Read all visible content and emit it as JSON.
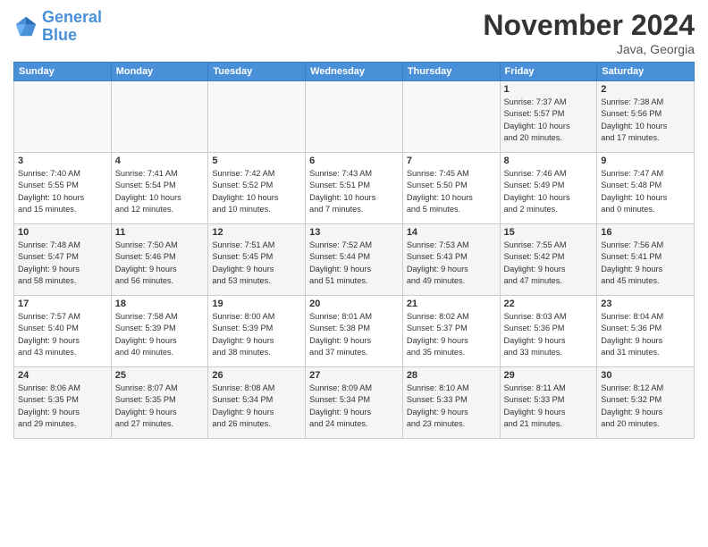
{
  "logo": {
    "line1": "General",
    "line2": "Blue"
  },
  "title": "November 2024",
  "location": "Java, Georgia",
  "days_of_week": [
    "Sunday",
    "Monday",
    "Tuesday",
    "Wednesday",
    "Thursday",
    "Friday",
    "Saturday"
  ],
  "weeks": [
    [
      {
        "day": "",
        "info": ""
      },
      {
        "day": "",
        "info": ""
      },
      {
        "day": "",
        "info": ""
      },
      {
        "day": "",
        "info": ""
      },
      {
        "day": "",
        "info": ""
      },
      {
        "day": "1",
        "info": "Sunrise: 7:37 AM\nSunset: 5:57 PM\nDaylight: 10 hours\nand 20 minutes."
      },
      {
        "day": "2",
        "info": "Sunrise: 7:38 AM\nSunset: 5:56 PM\nDaylight: 10 hours\nand 17 minutes."
      }
    ],
    [
      {
        "day": "3",
        "info": "Sunrise: 7:40 AM\nSunset: 5:55 PM\nDaylight: 10 hours\nand 15 minutes."
      },
      {
        "day": "4",
        "info": "Sunrise: 7:41 AM\nSunset: 5:54 PM\nDaylight: 10 hours\nand 12 minutes."
      },
      {
        "day": "5",
        "info": "Sunrise: 7:42 AM\nSunset: 5:52 PM\nDaylight: 10 hours\nand 10 minutes."
      },
      {
        "day": "6",
        "info": "Sunrise: 7:43 AM\nSunset: 5:51 PM\nDaylight: 10 hours\nand 7 minutes."
      },
      {
        "day": "7",
        "info": "Sunrise: 7:45 AM\nSunset: 5:50 PM\nDaylight: 10 hours\nand 5 minutes."
      },
      {
        "day": "8",
        "info": "Sunrise: 7:46 AM\nSunset: 5:49 PM\nDaylight: 10 hours\nand 2 minutes."
      },
      {
        "day": "9",
        "info": "Sunrise: 7:47 AM\nSunset: 5:48 PM\nDaylight: 10 hours\nand 0 minutes."
      }
    ],
    [
      {
        "day": "10",
        "info": "Sunrise: 7:48 AM\nSunset: 5:47 PM\nDaylight: 9 hours\nand 58 minutes."
      },
      {
        "day": "11",
        "info": "Sunrise: 7:50 AM\nSunset: 5:46 PM\nDaylight: 9 hours\nand 56 minutes."
      },
      {
        "day": "12",
        "info": "Sunrise: 7:51 AM\nSunset: 5:45 PM\nDaylight: 9 hours\nand 53 minutes."
      },
      {
        "day": "13",
        "info": "Sunrise: 7:52 AM\nSunset: 5:44 PM\nDaylight: 9 hours\nand 51 minutes."
      },
      {
        "day": "14",
        "info": "Sunrise: 7:53 AM\nSunset: 5:43 PM\nDaylight: 9 hours\nand 49 minutes."
      },
      {
        "day": "15",
        "info": "Sunrise: 7:55 AM\nSunset: 5:42 PM\nDaylight: 9 hours\nand 47 minutes."
      },
      {
        "day": "16",
        "info": "Sunrise: 7:56 AM\nSunset: 5:41 PM\nDaylight: 9 hours\nand 45 minutes."
      }
    ],
    [
      {
        "day": "17",
        "info": "Sunrise: 7:57 AM\nSunset: 5:40 PM\nDaylight: 9 hours\nand 43 minutes."
      },
      {
        "day": "18",
        "info": "Sunrise: 7:58 AM\nSunset: 5:39 PM\nDaylight: 9 hours\nand 40 minutes."
      },
      {
        "day": "19",
        "info": "Sunrise: 8:00 AM\nSunset: 5:39 PM\nDaylight: 9 hours\nand 38 minutes."
      },
      {
        "day": "20",
        "info": "Sunrise: 8:01 AM\nSunset: 5:38 PM\nDaylight: 9 hours\nand 37 minutes."
      },
      {
        "day": "21",
        "info": "Sunrise: 8:02 AM\nSunset: 5:37 PM\nDaylight: 9 hours\nand 35 minutes."
      },
      {
        "day": "22",
        "info": "Sunrise: 8:03 AM\nSunset: 5:36 PM\nDaylight: 9 hours\nand 33 minutes."
      },
      {
        "day": "23",
        "info": "Sunrise: 8:04 AM\nSunset: 5:36 PM\nDaylight: 9 hours\nand 31 minutes."
      }
    ],
    [
      {
        "day": "24",
        "info": "Sunrise: 8:06 AM\nSunset: 5:35 PM\nDaylight: 9 hours\nand 29 minutes."
      },
      {
        "day": "25",
        "info": "Sunrise: 8:07 AM\nSunset: 5:35 PM\nDaylight: 9 hours\nand 27 minutes."
      },
      {
        "day": "26",
        "info": "Sunrise: 8:08 AM\nSunset: 5:34 PM\nDaylight: 9 hours\nand 26 minutes."
      },
      {
        "day": "27",
        "info": "Sunrise: 8:09 AM\nSunset: 5:34 PM\nDaylight: 9 hours\nand 24 minutes."
      },
      {
        "day": "28",
        "info": "Sunrise: 8:10 AM\nSunset: 5:33 PM\nDaylight: 9 hours\nand 23 minutes."
      },
      {
        "day": "29",
        "info": "Sunrise: 8:11 AM\nSunset: 5:33 PM\nDaylight: 9 hours\nand 21 minutes."
      },
      {
        "day": "30",
        "info": "Sunrise: 8:12 AM\nSunset: 5:32 PM\nDaylight: 9 hours\nand 20 minutes."
      }
    ]
  ]
}
